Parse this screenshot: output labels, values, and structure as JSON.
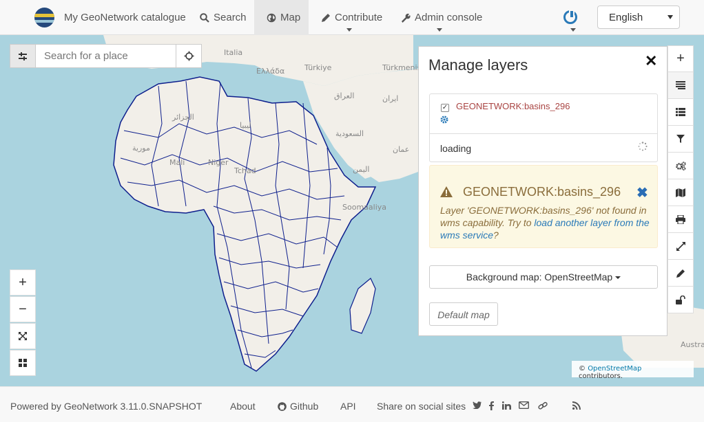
{
  "header": {
    "brand": "My GeoNetwork catalogue",
    "nav": [
      {
        "label": "Search",
        "icon": "search-icon"
      },
      {
        "label": "Map",
        "icon": "globe-icon"
      },
      {
        "label": "Contribute",
        "icon": "pencil-icon"
      },
      {
        "label": "Admin console",
        "icon": "wrench-icon"
      }
    ],
    "language": "English"
  },
  "map": {
    "search_placeholder": "Search for a place",
    "labels": [
      "Italia",
      "Ελλάδα",
      "Türkiye",
      "Türkmenis",
      "العراق",
      "ایران",
      "السعودية",
      "عمان",
      "اليمن",
      "ليبيا",
      "الجزائر",
      "مورية",
      "Mali",
      "Niger",
      "Tchad",
      "Soomaaliya",
      "Austra"
    ],
    "attribution": {
      "prefix": "©",
      "link": "OpenStreetMap",
      "suffix": "contributors."
    }
  },
  "panel": {
    "title": "Manage layers",
    "layer_name": "GEONETWORK:basins_296",
    "layer_checked": true,
    "loading_text": "loading",
    "warning": {
      "title": "GEONETWORK:basins_296",
      "text_1": "Layer 'GEONETWORK:basins_296' not found in wms capability. Try to ",
      "link": "load another layer from the wms service",
      "text_2": "?"
    },
    "background_button": "Background map: OpenStreetMap",
    "default_button": "Default map"
  },
  "footer": {
    "powered_by": "Powered by GeoNetwork 3.11.0.SNAPSHOT",
    "about": "About",
    "github": "Github",
    "api": "API",
    "share": "Share on social sites"
  },
  "colors": {
    "accent": "#2a7ab8",
    "warning_text": "#8a6d3b",
    "warning_bg": "#fcf8e3",
    "water": "#aad3df",
    "land": "#f2efe9",
    "basin_lines": "#0d1e8c"
  }
}
